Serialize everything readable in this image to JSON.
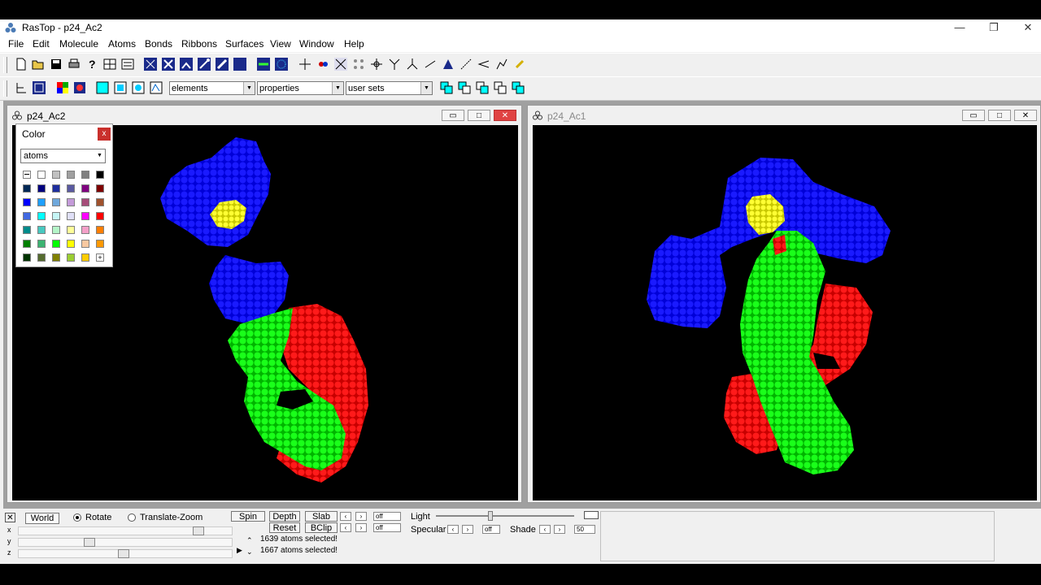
{
  "window": {
    "title": "RasTop - p24_Ac2",
    "minimize": "—",
    "restore": "❐",
    "close": "✕"
  },
  "menu": [
    "File",
    "Edit",
    "Molecule",
    "Atoms",
    "Bonds",
    "Ribbons",
    "Surfaces",
    "View",
    "Window",
    "Help"
  ],
  "toolbar2": {
    "combo1": "elements",
    "combo2": "properties",
    "combo3": "user sets"
  },
  "child1": {
    "title": "p24_Ac2"
  },
  "child2": {
    "title": "p24_Ac1"
  },
  "child_buttons": {
    "min": "▭",
    "max": "□",
    "close": "✕"
  },
  "color_panel": {
    "title": "Color",
    "close": "x",
    "select": "atoms",
    "swatches": [
      [
        "none",
        "#ffffff",
        "#c0c0c0",
        "#a0a0a0",
        "#808080",
        "#000000"
      ],
      [
        "#002855",
        "#00007f",
        "#1f2e9e",
        "#5a5aa0",
        "#7f007f",
        "#7f0000"
      ],
      [
        "#0000ff",
        "#1f9fff",
        "#6fa8dc",
        "#c49bd9",
        "#a64d79",
        "#a0522d"
      ],
      [
        "#4169e1",
        "#00ffff",
        "#c6f6f6",
        "#e0e0f8",
        "#ff00ff",
        "#ff0000"
      ],
      [
        "#008b8b",
        "#48c9c0",
        "#b4f5c8",
        "#ffff99",
        "#f4a0c8",
        "#ff7f00"
      ],
      [
        "#007f00",
        "#3cb371",
        "#00ff00",
        "#ffff00",
        "#f8c8a0",
        "#ff9900"
      ],
      [
        "#003300",
        "#556b2f",
        "#808000",
        "#9acd32",
        "#ffcc00",
        "plus"
      ]
    ]
  },
  "bottom": {
    "mode_world": "World",
    "rotate": "Rotate",
    "translate_zoom": "Translate-Zoom",
    "axes": [
      "x",
      "y",
      "z"
    ],
    "spin": "Spin",
    "depth": "Depth",
    "slab": "Slab",
    "reset": "Reset",
    "bclip": "BClip",
    "off1": "off",
    "off2": "off",
    "light": "Light",
    "specular": "Specular",
    "spec_off": "off",
    "shade": "Shade",
    "shade_val": "50",
    "msg1": "1639 atoms selected!",
    "msg2": "1667 atoms selected!"
  }
}
